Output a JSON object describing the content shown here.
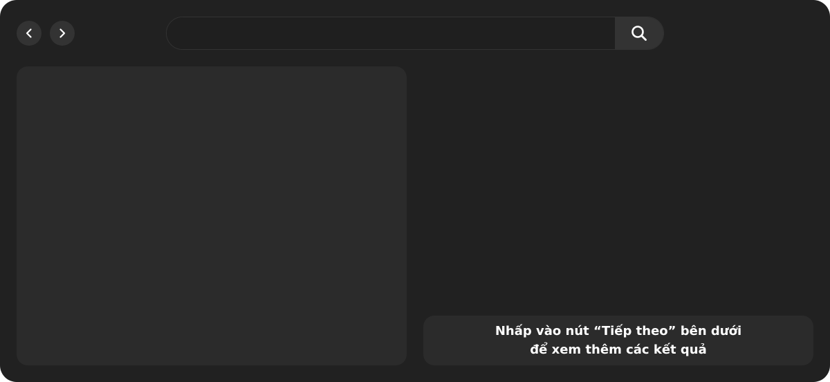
{
  "navigation": {
    "prev_icon": "chevron-left-icon",
    "next_icon": "chevron-right-icon"
  },
  "search": {
    "value": "",
    "placeholder": "",
    "button_icon": "search-icon"
  },
  "hint": {
    "line1": "Nhấp vào nút “Tiếp theo” bên dưới",
    "line2": "để xem thêm các kết quả"
  },
  "colors": {
    "background": "#212121",
    "surface": "#2b2b2b",
    "control": "#333333",
    "text": "#ffffff"
  }
}
